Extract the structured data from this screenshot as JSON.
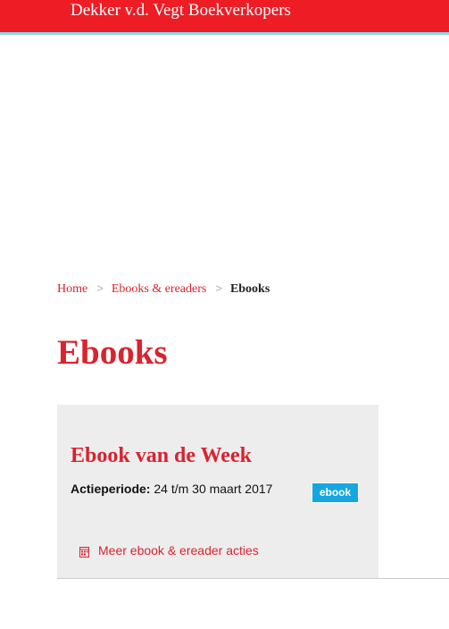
{
  "header": {
    "site_title": "Dekker v.d. Vegt Boekverkopers",
    "colors": {
      "bar": "#ee1c25",
      "underline": "#8fd3ee"
    }
  },
  "breadcrumb": {
    "items": [
      "Home",
      "Ebooks & ereaders"
    ],
    "current": "Ebooks",
    "separator": ">"
  },
  "page": {
    "title": "Ebooks",
    "accent_color": "#d9232d"
  },
  "promo_card": {
    "title": "Ebook van de Week",
    "period_label": "Actieperiode:",
    "period_value": " 24 t/m 30 maart 2017",
    "badge": "ebook",
    "badge_color": "#14a7e1",
    "link_icon": "calendar-icon",
    "link_text": "Meer ebook & ereader acties"
  }
}
